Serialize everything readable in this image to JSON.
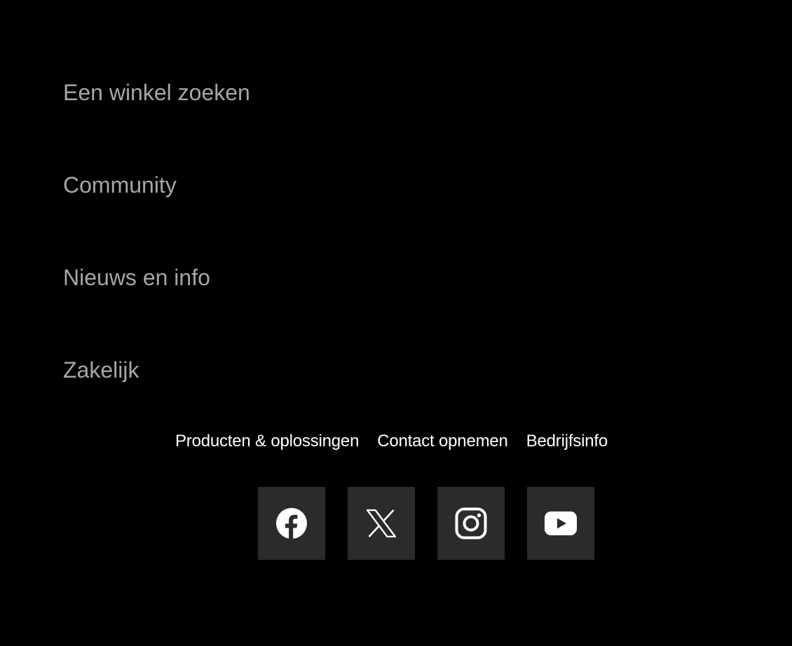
{
  "menu": {
    "items": [
      {
        "label": "Een winkel zoeken"
      },
      {
        "label": "Community"
      },
      {
        "label": "Nieuws en info"
      },
      {
        "label": "Zakelijk"
      }
    ]
  },
  "footer": {
    "links": [
      {
        "label": "Producten & oplossingen"
      },
      {
        "label": "Contact opnemen"
      },
      {
        "label": "Bedrijfsinfo"
      }
    ],
    "social": [
      {
        "icon": "facebook-icon"
      },
      {
        "icon": "x-icon"
      },
      {
        "icon": "instagram-icon"
      },
      {
        "icon": "youtube-icon"
      }
    ]
  },
  "colors": {
    "background": "#000000",
    "menu_text": "#a6a6a6",
    "footer_link_text": "#ffffff",
    "social_tile": "#2b2b2b",
    "icon": "#ffffff"
  }
}
